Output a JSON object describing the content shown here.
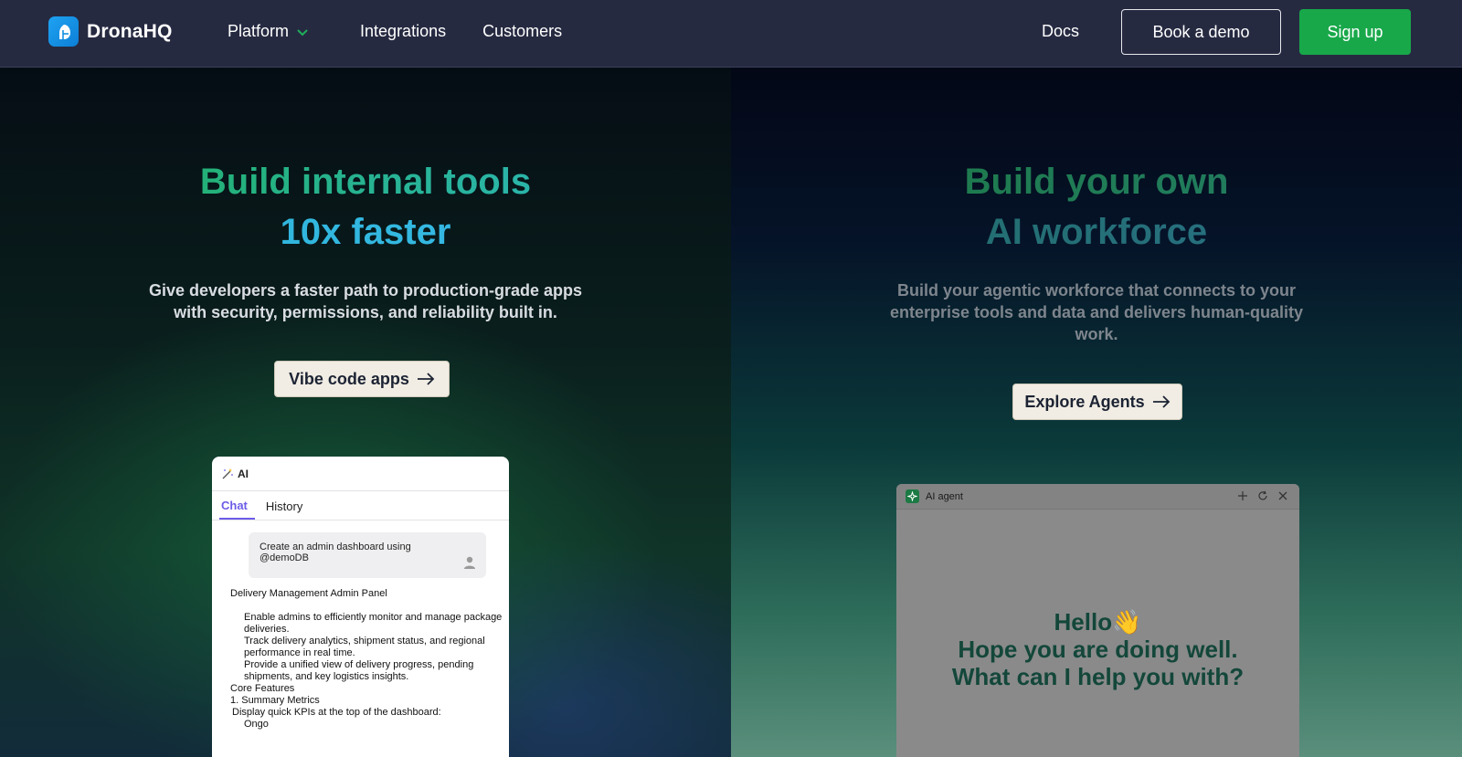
{
  "nav": {
    "brand": "DronaHQ",
    "links": [
      {
        "label": "Platform",
        "has_dropdown": true
      },
      {
        "label": "Integrations"
      },
      {
        "label": "Customers"
      }
    ],
    "docs": "Docs",
    "book_demo": "Book a demo",
    "sign_up": "Sign up"
  },
  "left": {
    "title_line1": "Build internal tools",
    "title_line2": "10x faster",
    "subtitle": "Give developers a faster path to production-grade apps with security, permissions, and reliability built in.",
    "cta": "Vibe code apps",
    "chat": {
      "header": "AI",
      "tabs": [
        "Chat",
        "History"
      ],
      "active_tab": "Chat",
      "user_message": "Create an admin dashboard using @demoDB",
      "response": {
        "heading": "Delivery Management Admin Panel",
        "items": [
          "Enable admins to efficiently monitor and manage package deliveries.",
          "Track delivery analytics, shipment status, and regional performance in real time.",
          "Provide a unified view of delivery progress, pending shipments, and key logistics insights."
        ],
        "core_features": "Core Features",
        "feature1": "1. Summary Metrics",
        "feature1_desc": "Display quick KPIs at the top of the dashboard:",
        "feature1_item": "Ongo"
      }
    }
  },
  "right": {
    "title_line1": "Build your own",
    "title_line2": "AI workforce",
    "subtitle": "Build your agentic workforce that connects to your enterprise tools and data and delivers human-quality work.",
    "cta": "Explore Agents",
    "agent": {
      "header": "AI agent",
      "greeting": "Hello👋",
      "line2": "Hope you are doing well.",
      "line3": "What can I help you with?"
    }
  },
  "colors": {
    "nav_bg": "#262a41",
    "signup": "#18a84a",
    "accent_purple": "#6c5ce7",
    "agent_text": "#13473a"
  }
}
